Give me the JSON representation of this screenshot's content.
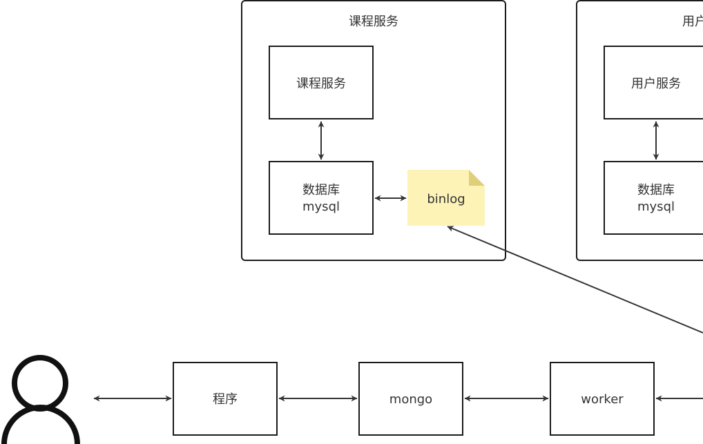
{
  "course_group": {
    "title": "课程服务",
    "service_label": "课程服务",
    "db_line1": "数据库",
    "db_line2": "mysql",
    "binlog_label": "binlog"
  },
  "user_group": {
    "title": "用户",
    "service_label": "用户服务",
    "db_line1": "数据库",
    "db_line2": "mysql"
  },
  "pipeline": {
    "program_label": "程序",
    "mongo_label": "mongo",
    "worker_label": "worker"
  },
  "colors": {
    "stroke": "#1a1a1a",
    "arrow": "#333333",
    "note_fill": "#fdf3b6",
    "note_fold": "#e0cf7a"
  }
}
